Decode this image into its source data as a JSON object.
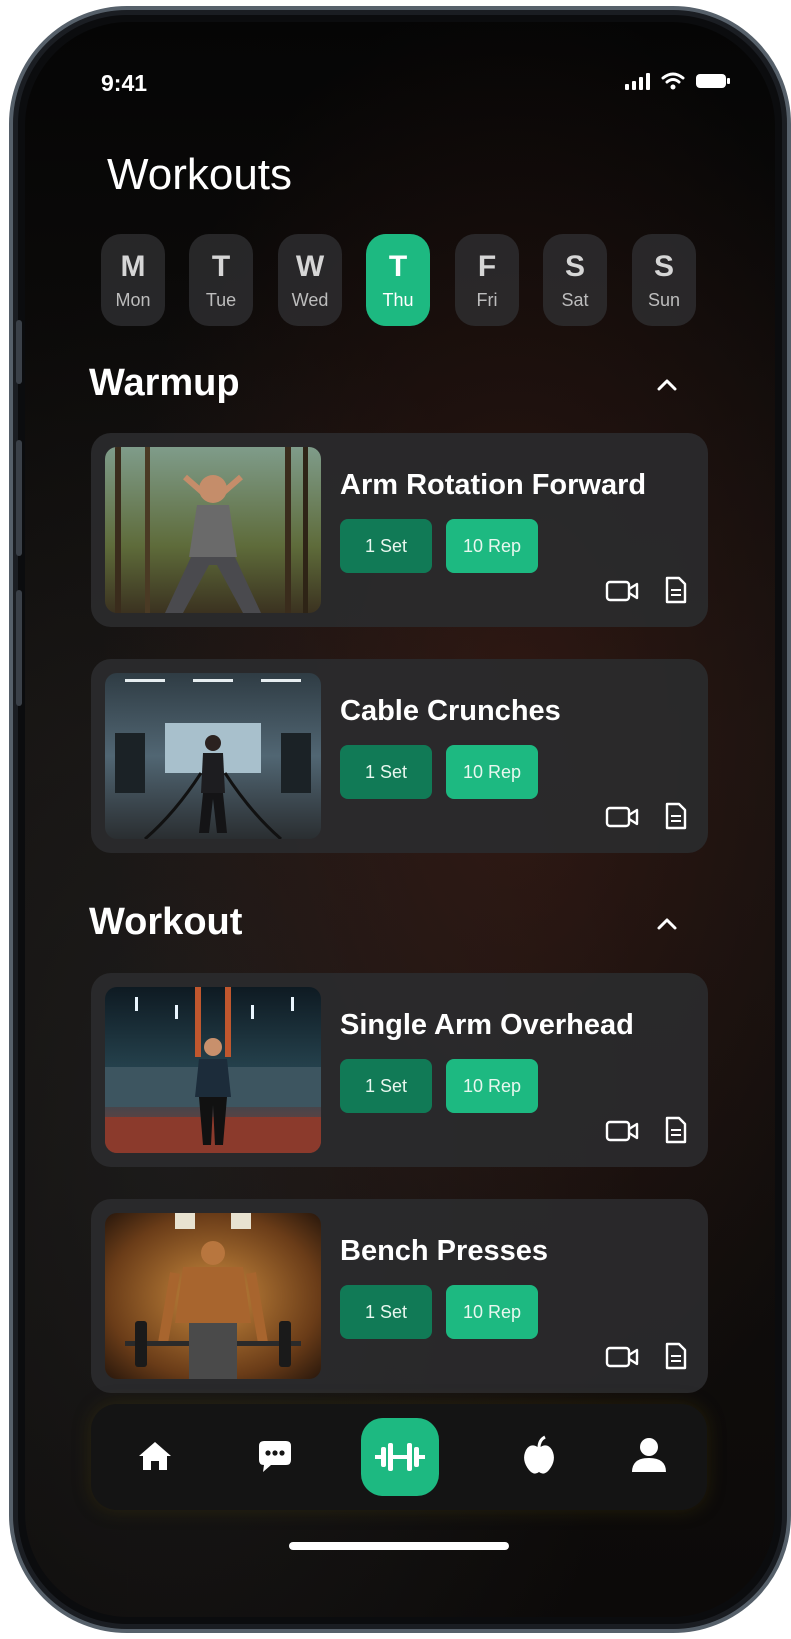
{
  "status": {
    "time": "9:41"
  },
  "page": {
    "title": "Workouts"
  },
  "days": [
    {
      "letter": "M",
      "name": "Mon",
      "active": false
    },
    {
      "letter": "T",
      "name": "Tue",
      "active": false
    },
    {
      "letter": "W",
      "name": "Wed",
      "active": false
    },
    {
      "letter": "T",
      "name": "Thu",
      "active": true
    },
    {
      "letter": "F",
      "name": "Fri",
      "active": false
    },
    {
      "letter": "S",
      "name": "Sat",
      "active": false
    },
    {
      "letter": "S",
      "name": "Sun",
      "active": false
    }
  ],
  "sections": [
    {
      "title": "Warmup",
      "items": [
        {
          "name": "Arm Rotation Forward",
          "sets": "1 Set",
          "reps": "10 Rep"
        },
        {
          "name": "Cable Crunches",
          "sets": "1 Set",
          "reps": "10 Rep"
        }
      ]
    },
    {
      "title": "Workout",
      "items": [
        {
          "name": "Single Arm Overhead",
          "sets": "1 Set",
          "reps": "10 Rep"
        },
        {
          "name": "Bench Presses",
          "sets": "1 Set",
          "reps": "10 Rep"
        }
      ]
    }
  ],
  "nav": {
    "items": [
      "home-icon",
      "chat-icon",
      "dumbbell-icon",
      "apple-icon",
      "profile-icon"
    ],
    "active": "dumbbell-icon"
  },
  "colors": {
    "accent": "#1db981",
    "accent_dark": "#117a56",
    "card": "#2a2a2c",
    "background": "#0b0c0e"
  }
}
